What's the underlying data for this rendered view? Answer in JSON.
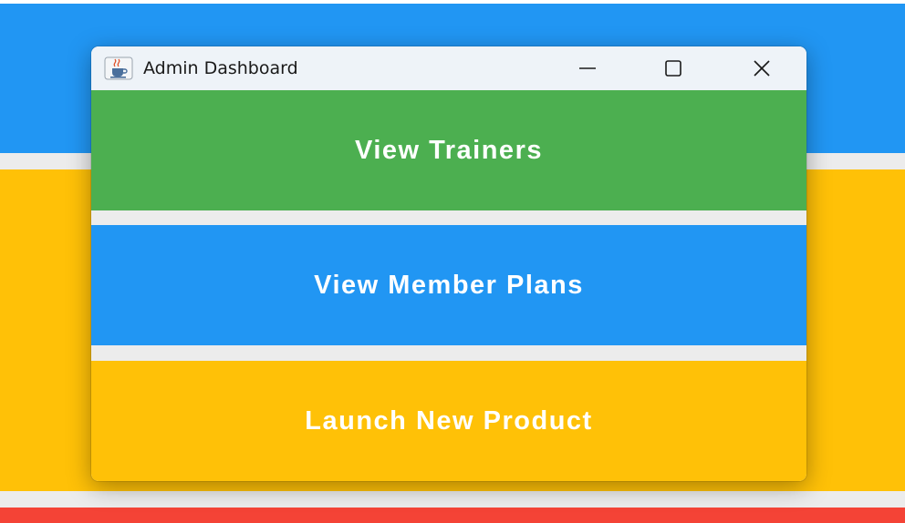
{
  "window": {
    "title": "Admin Dashboard",
    "icon": "java-cup-icon",
    "controls": [
      "minimize-icon",
      "maximize-icon",
      "close-icon"
    ]
  },
  "actions": [
    {
      "label": "View Trainers",
      "color": "#4CAF50"
    },
    {
      "label": "View Member Plans",
      "color": "#2196F3"
    },
    {
      "label": "Launch New Product",
      "color": "#FFC107"
    }
  ],
  "background": {
    "colors": [
      "#2196F3",
      "#FFC107",
      "#F44336"
    ]
  }
}
